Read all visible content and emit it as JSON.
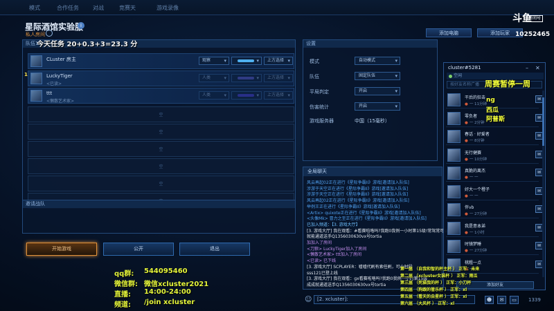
{
  "topnav": {
    "tabs": [
      "模式",
      "合作任务",
      "对战",
      "竞赛天",
      "游戏录像"
    ]
  },
  "lobby": {
    "title": "星际酒馆实验服",
    "info_icon": "i",
    "subtitle": "私人房间",
    "add_pc_label": "添加电脑",
    "add_player_label": "添加玩家",
    "team_header": "队伍1",
    "teammates_header": "邀请战队"
  },
  "players": [
    {
      "name": "CLuster 房主",
      "note": "",
      "role": "观察",
      "color": "#4fb0f0",
      "action": "上方选择",
      "dim": false
    },
    {
      "name": "LuckyTiger",
      "note": "<已读>",
      "role": "人类",
      "color": "#5a5ad0",
      "action": "上方选择",
      "dim": true
    },
    {
      "name": "ttt",
      "note": "<懒散艺术家>",
      "role": "人类",
      "color": "#4a3ed8",
      "action": "上方选择",
      "dim": true
    }
  ],
  "empty_slot_label": "空",
  "bottom_buttons": {
    "start": "开始游戏",
    "public": "公开",
    "leave": "退出"
  },
  "settings": {
    "header": "设置",
    "rows": [
      {
        "label": "模式",
        "value": "自动模式"
      },
      {
        "label": "队伍",
        "value": "固定队伍"
      },
      {
        "label": "平局判定",
        "value": "开启"
      },
      {
        "label": "伤害统计",
        "value": "开启"
      }
    ],
    "server_label": "游戏服务器",
    "server_value": "中国（15毫秒）"
  },
  "chat": {
    "header": "全局聊天",
    "lines": [
      {
        "text": "风云再起02正在进行《星际争霸II》游戏[邀请加入队伍]",
        "color": "#4fa0f0"
      },
      {
        "text": "涉游于天空正在进行《星际争霸II》游戏[邀请加入队伍]",
        "color": "#4fa0f0"
      },
      {
        "text": "涉游于天空正在进行《星际争霸II》游戏[邀请加入队伍]",
        "color": "#4fa0f0"
      },
      {
        "text": "风云再起02正在进行《星际争霸II》游戏[邀请加入队伍]",
        "color": "#4fa0f0"
      },
      {
        "text": "举例王正在进行《星际争霸II》游戏[邀请加入队伍]",
        "color": "#4fa0f0"
      },
      {
        "text": "<Artix> quixote正在进行《星际争霸II》游戏[邀请加入队伍]",
        "color": "#4fa0f0"
      },
      {
        "text": "<头像Mk> 冒力之至正在进行《星际争霸II》游戏[邀请加入队伍]",
        "color": "#4fa0f0"
      },
      {
        "text": "已加入频道：【3. 游戏大厅】",
        "color": "#6fc1ff"
      },
      {
        "text": "[3. 游戏大厅] 我在观看：#看赛啦咯吗?我跑0我例一小时第15级!常驾常可以",
        "color": "#e0e6ee"
      },
      {
        "text": "就能通道送手Q1356030630vx号tortia",
        "color": "#e0e6ee"
      },
      {
        "text": "加加入了房间",
        "color": "#c68ff0"
      },
      {
        "text": "<刀狼> LuckyTiger加入了房间",
        "color": "#c68ff0"
      },
      {
        "text": "<懒散艺术家> ttt加入了房间",
        "color": "#c68ff0"
      },
      {
        "text": "<已读> 已下线",
        "color": "#c68ff0"
      },
      {
        "text": "[3. 游戏大厅] SCPLAYER：嘘嘘代刷有索任刷，可小时段",
        "color": "#e0e6ee"
      },
      {
        "text": "sss121已登上线",
        "color": "#e0e6ee"
      },
      {
        "text": "[3. 游戏大厅] 我在观看：gx看赛啦咯吗?我跑0我例一小时第15级",
        "color": "#e0e6ee"
      },
      {
        "text": "成成就通道送手Q1356030630vx号tortia",
        "color": "#e0e6ee"
      }
    ],
    "input_value": "[2. xcluster]:"
  },
  "friends": {
    "title": "cluster#5281",
    "status": "空闲",
    "search_placeholder": "按好友名称广播",
    "list": [
      {
        "name": "干后的狂击",
        "status": "一 11分钟"
      },
      {
        "name": "零负者",
        "status": "一 2分钟"
      },
      {
        "name": "春话 · 好爱者",
        "status": "一 8分钟"
      },
      {
        "name": "无行健赛",
        "status": "一 10分钟"
      },
      {
        "name": "真脆的离杰",
        "status": "一 一"
      },
      {
        "name": "好大一个橙子",
        "status": "一 一"
      },
      {
        "name": "伴vb",
        "status": "一 27分钟"
      },
      {
        "name": "我是意本弟",
        "status": "一 1小时"
      },
      {
        "name": "时镜梦睡",
        "status": "一 27分钟"
      },
      {
        "name": "桃粗一点",
        "status": "一 一"
      }
    ],
    "add_friend_label": "添加好友"
  },
  "bottom_bar": {
    "icons": [
      "users-icon",
      "chat-icon",
      "monitor-icon"
    ],
    "count": "1339"
  },
  "overlay": {
    "task": "今天任务 20+0.3+3=23.3 分",
    "row_number": "1",
    "weekly_pause": "周赛暂停一周",
    "side_notes": [
      "ng",
      "西瓜",
      "阿普斯"
    ],
    "info": [
      {
        "label": "qq群:",
        "value": "544095460"
      },
      {
        "label": "微信群:",
        "value": "微信xcluster2021"
      },
      {
        "label": "直播:",
        "value": "14:00-24:00"
      },
      {
        "label": "频道:",
        "value": "/join xcluster"
      }
    ],
    "ranks": [
      "第一届 （自我和智的杯主杯 ） 正军：未来",
      "第二届 （xcluster女装杯 ） 正军：雨瓜",
      "第三届 （死猫我的杯 ） 正军：小刀杯",
      "第四届 （狗跟的管乐杯 ） 正军：xl",
      "第五届 （看天的自星杯 ） 正军：xl",
      "第六届 （大风杯 ） 正军：xl"
    ],
    "logo_mark": "斗鱼",
    "logo_tag": "房间号",
    "room_id": "10252465"
  }
}
